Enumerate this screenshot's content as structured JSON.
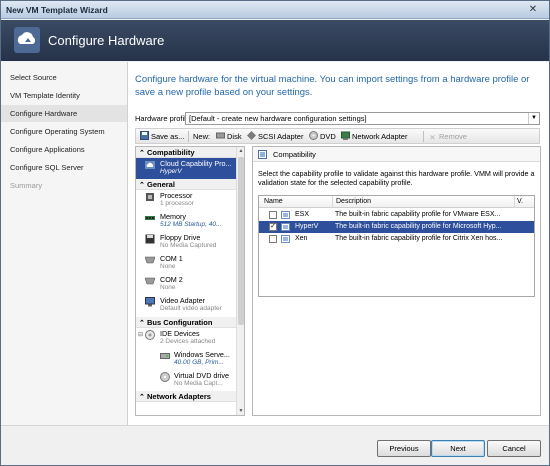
{
  "window": {
    "title": "New VM Template Wizard",
    "close_glyph": "✕"
  },
  "banner": {
    "title": "Configure Hardware"
  },
  "nav": {
    "items": [
      {
        "label": "Select Source"
      },
      {
        "label": "VM Template Identity"
      },
      {
        "label": "Configure Hardware"
      },
      {
        "label": "Configure Operating System"
      },
      {
        "label": "Configure Applications"
      },
      {
        "label": "Configure SQL Server"
      },
      {
        "label": "Summary"
      }
    ]
  },
  "main": {
    "intro": "Configure hardware for the virtual machine. You can import settings from a hardware profile or save a new profile based on your settings.",
    "profile_label": "Hardware profile:",
    "profile_value": "[Default - create new hardware configuration settings]"
  },
  "toolbar": {
    "save_as": "Save as...",
    "new_label": "New:",
    "disk": "Disk",
    "scsi": "SCSI Adapter",
    "dvd": "DVD",
    "network": "Network Adapter",
    "remove": "Remove"
  },
  "tree": {
    "sections": {
      "compatibility": "Compatibility",
      "general": "General",
      "bus": "Bus Configuration",
      "network": "Network Adapters"
    },
    "cloud": {
      "title": "Cloud Capability Pro...",
      "value": "HyperV"
    },
    "general_items": [
      {
        "title": "Processor",
        "value": "1 processor"
      },
      {
        "title": "Memory",
        "value": "512 MB Startup, 40..."
      },
      {
        "title": "Floppy Drive",
        "value": "No Media Captured"
      },
      {
        "title": "COM 1",
        "value": "None"
      },
      {
        "title": "COM 2",
        "value": "None"
      },
      {
        "title": "Video Adapter",
        "value": "Default video adapter"
      }
    ],
    "ide": {
      "title": "IDE Devices",
      "value": "2 Devices attached"
    },
    "ide_items": [
      {
        "title": "Windows Serve...",
        "value": "40.00 GB, Prim..."
      },
      {
        "title": "Virtual DVD drive",
        "value": "No Media Capt..."
      }
    ]
  },
  "detail": {
    "title": "Compatibility",
    "description": "Select the capability profile to validate against this hardware profile. VMM will provide a validation state for the selected capability profile.",
    "columns": {
      "name": "Name",
      "description": "Description",
      "v": "V."
    },
    "rows": [
      {
        "name": "ESX",
        "description": "The built-in fabric capability profile for VMware ESX...",
        "checked": false
      },
      {
        "name": "HyperV",
        "description": "The built-in fabric capability profile for Microsoft Hyp...",
        "checked": true
      },
      {
        "name": "Xen",
        "description": "The built-in fabric capability profile for Citrix Xen hos...",
        "checked": false
      }
    ]
  },
  "footer": {
    "previous": "Previous",
    "next": "Next",
    "cancel": "Cancel"
  },
  "colors": {
    "accent_text": "#2468a8",
    "selection": "#2e4f9b",
    "banner": "#2f3d56"
  }
}
